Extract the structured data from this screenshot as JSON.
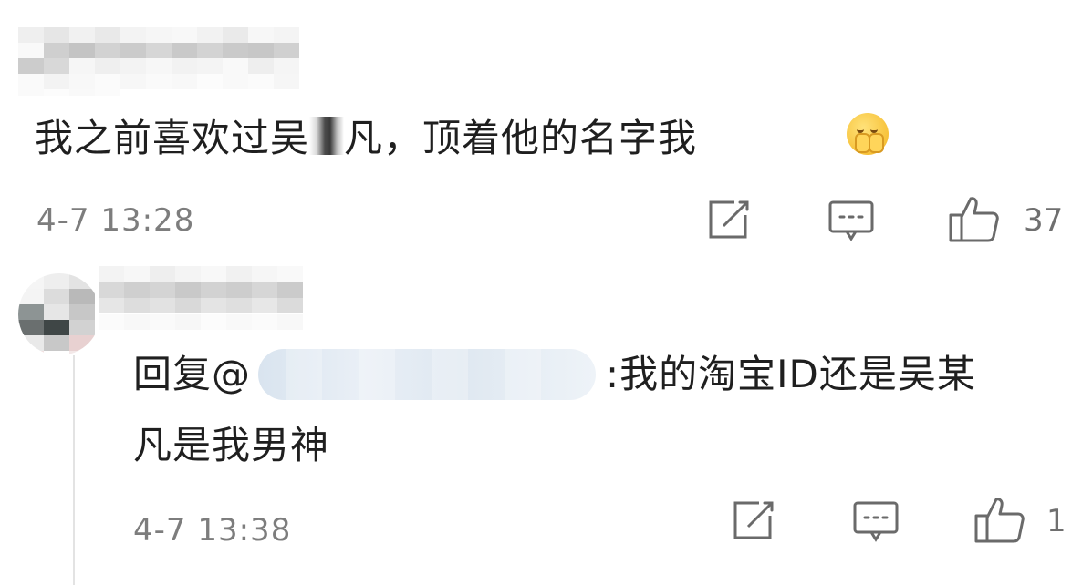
{
  "comment": {
    "text_before_redaction": "我之前喜欢过吴",
    "text_after_redaction": "凡，顶着他的名字我",
    "emoji": "face-with-hand-over-mouth-icon",
    "timestamp": "4-7 13:28",
    "like_count": "37"
  },
  "reply": {
    "prefix": "回复@",
    "text_line1": ":我的淘宝ID还是吴某",
    "text_line2": "凡是我男神",
    "timestamp": "4-7 13:38",
    "like_count": "1"
  },
  "actions": {
    "share_icon": "share-edit-icon",
    "comment_icon": "comment-bubble-icon",
    "like_icon": "thumbs-up-icon"
  },
  "colors": {
    "text": "#1f1f1f",
    "meta": "#7d7d7d",
    "icon": "#6a6a6a"
  }
}
